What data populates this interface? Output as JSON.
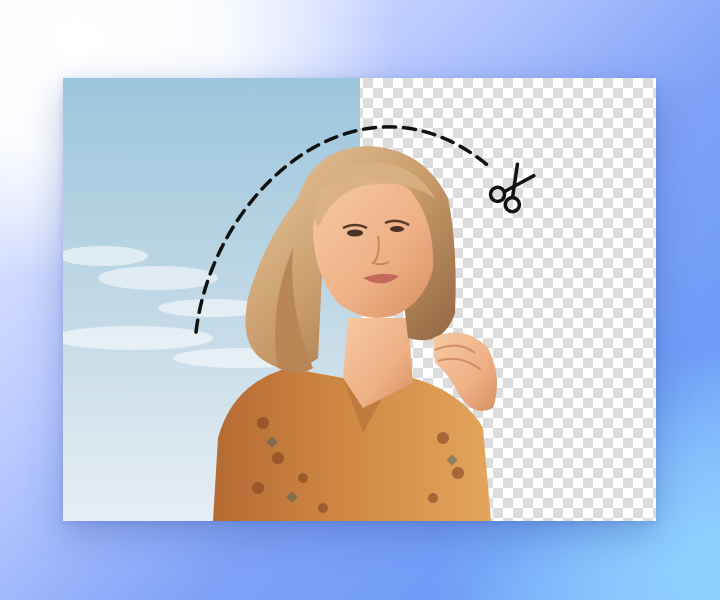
{
  "image": {
    "subject": "portrait-woman",
    "left_half": "original-photo-sky-background",
    "right_half": "transparent-checkerboard-background",
    "colors": {
      "sky_top": "#9cc6dd",
      "sky_bottom": "#e7eef3",
      "checker_light": "#ffffff",
      "checker_dark": "#dcdcdc",
      "hair": "#c99b6a",
      "skin": "#f1b68c",
      "shirt": "#c9793a",
      "page_accent": "#6f9cf6"
    }
  },
  "overlay": {
    "cut_path_style": "dashed-arc",
    "tool_icon": "scissors-icon"
  }
}
